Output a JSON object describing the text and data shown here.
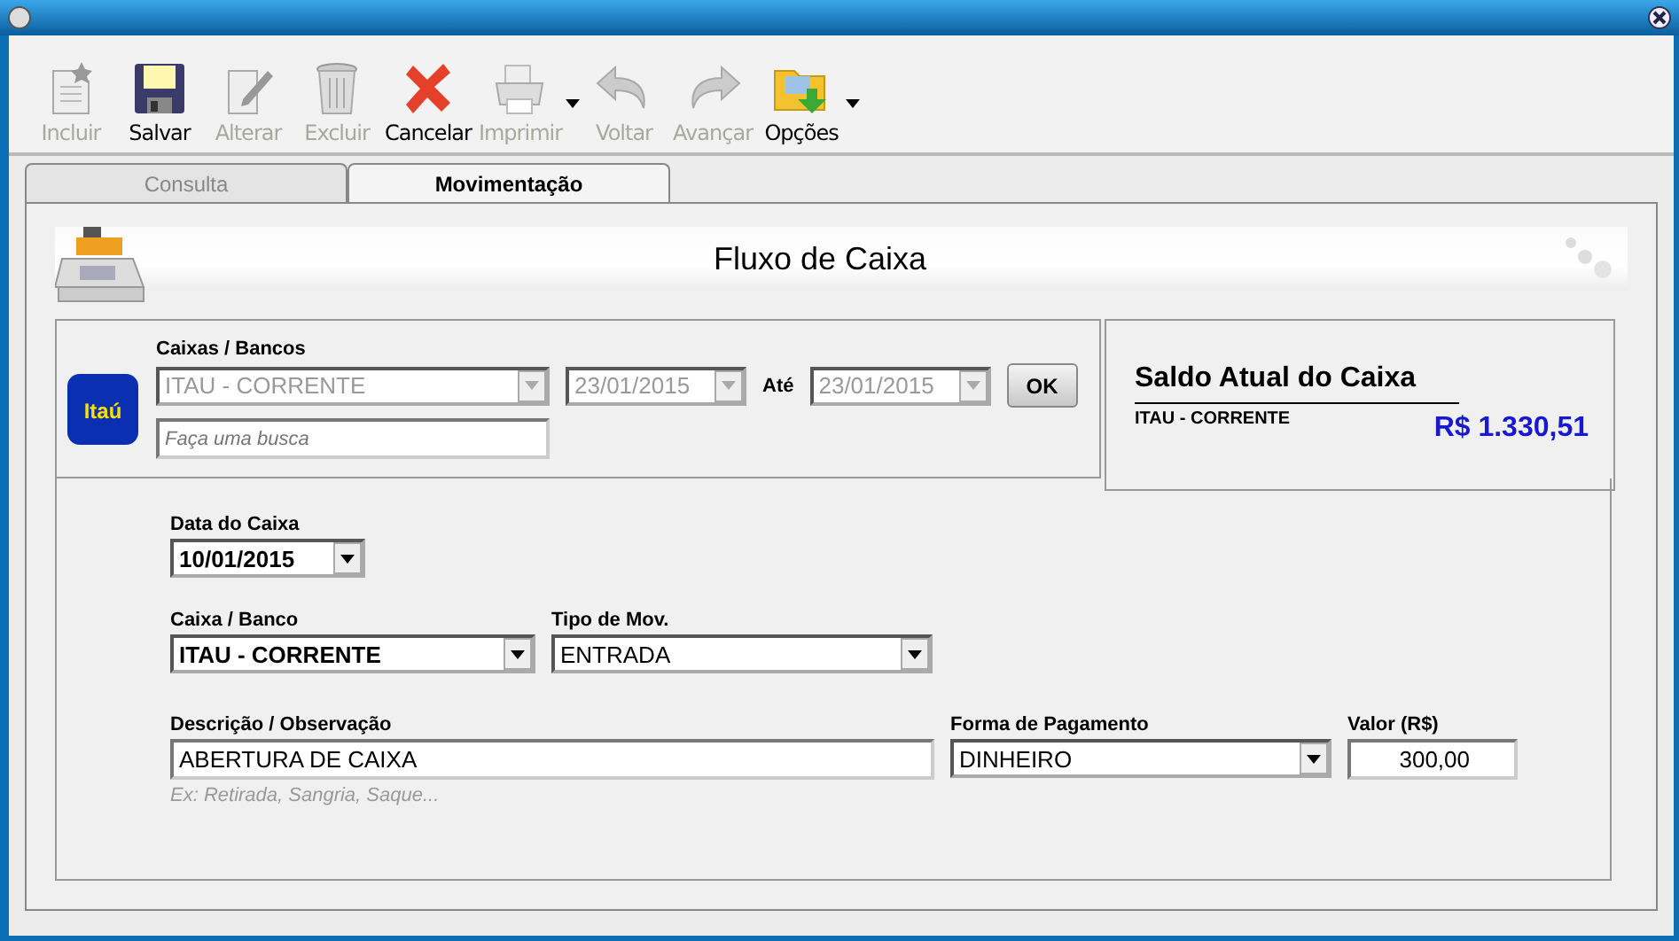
{
  "toolbar": [
    {
      "label": "Incluir",
      "disabled": true,
      "has_menu": false
    },
    {
      "label": "Salvar",
      "disabled": false,
      "has_menu": false
    },
    {
      "label": "Alterar",
      "disabled": true,
      "has_menu": false
    },
    {
      "label": "Excluir",
      "disabled": true,
      "has_menu": false
    },
    {
      "label": "Cancelar",
      "disabled": false,
      "has_menu": false
    },
    {
      "label": "Imprimir",
      "disabled": true,
      "has_menu": true
    },
    {
      "label": "Voltar",
      "disabled": true,
      "has_menu": false
    },
    {
      "label": "Avançar",
      "disabled": true,
      "has_menu": false
    },
    {
      "label": "Opções",
      "disabled": false,
      "has_menu": true
    }
  ],
  "tabs": [
    {
      "label": "Consulta",
      "selected": false
    },
    {
      "label": "Movimentação",
      "selected": true
    }
  ],
  "header": {
    "title": "Fluxo de Caixa"
  },
  "filter": {
    "label": "Caixas / Bancos",
    "account": {
      "value": "ITAU - CORRENTE",
      "disabled": true
    },
    "date_from": {
      "value": "23/01/2015",
      "disabled": true
    },
    "until_label": "Até",
    "date_to": {
      "value": "23/01/2015",
      "disabled": true
    },
    "ok_button": "OK",
    "search": {
      "placeholder": "Faça uma busca"
    },
    "bank_logo": "Itaú"
  },
  "balance": {
    "title": "Saldo Atual do Caixa",
    "account": "ITAU - CORRENTE",
    "amount": "R$ 1.330,51"
  },
  "form": {
    "date": {
      "label": "Data do Caixa",
      "value": "10/01/2015"
    },
    "account": {
      "label": "Caixa / Banco",
      "value": "ITAU - CORRENTE"
    },
    "type": {
      "label": "Tipo de Mov.",
      "value": "ENTRADA"
    },
    "description": {
      "label": "Descrição / Observação",
      "value": "ABERTURA DE CAIXA",
      "hint": "Ex: Retirada, Sangria, Saque..."
    },
    "payment": {
      "label": "Forma de Pagamento",
      "value": "DINHEIRO"
    },
    "amount": {
      "label": "Valor (R$)",
      "value": "300,00"
    }
  }
}
